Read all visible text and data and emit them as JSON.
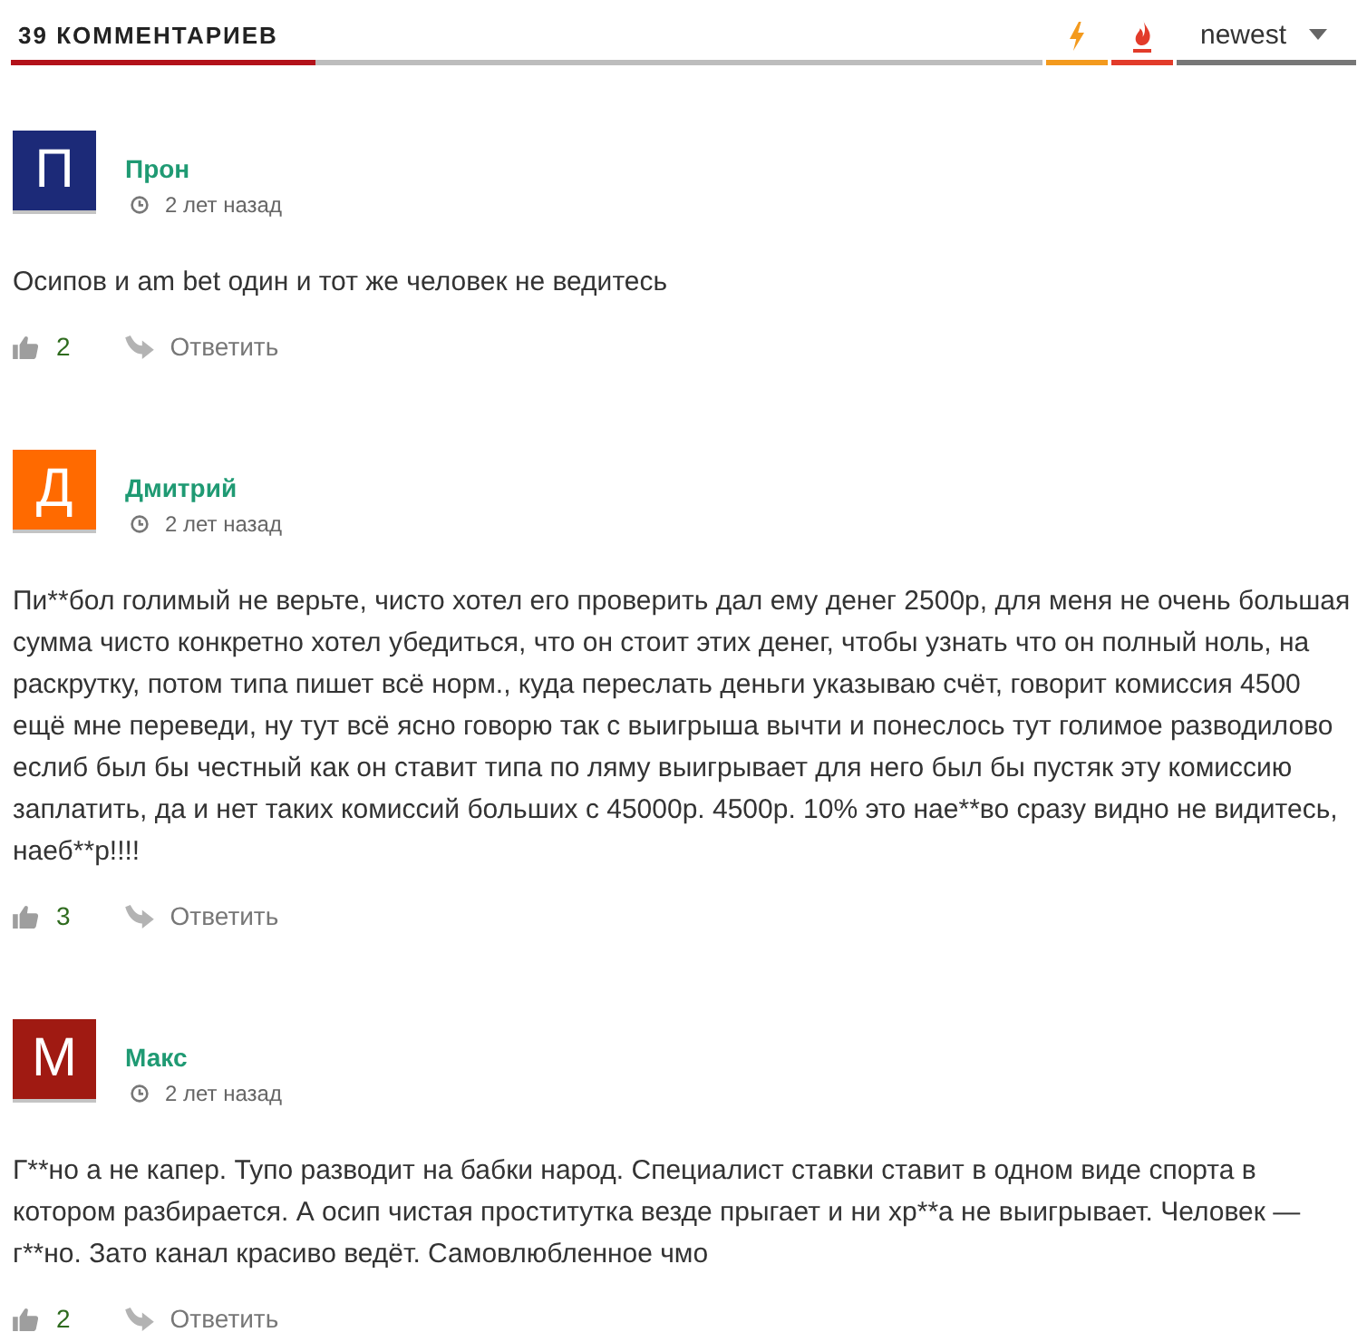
{
  "header": {
    "title": "39 КОММЕНТАРИЕВ"
  },
  "sort": {
    "tabs": [
      {
        "kind": "trending",
        "color": "#f39a1e"
      },
      {
        "kind": "hottest",
        "color": "#e23b2a"
      }
    ],
    "dropdown": {
      "value": "newest"
    }
  },
  "comments": [
    {
      "avatar_letter": "П",
      "color": "#1c2a78",
      "author": "Прон",
      "time": "2 лет назад",
      "text": "Осипов и am bet один и тот же человек не ведитесь",
      "likes": "2",
      "reply": "Ответить"
    },
    {
      "avatar_letter": "Д",
      "color": "#ff6a00",
      "author": "Дмитрий",
      "time": "2 лет назад",
      "text": "Пи**бол голимый не верьте, чисто хотел его проверить дал ему денег 2500р, для меня не очень большая сумма чисто конкретно хотел убедиться, что он стоит этих денег, чтобы узнать что он полный ноль, на раскрутку, потом типа пишет всё норм., куда переслать деньги указываю счёт, говорит комиссия 4500 ещё мне переведи, ну тут всё ясно говорю так с выигрыша вычти и понеслось тут голимое разводилово еслиб был бы честный как он ставит типа по ляму выигрывает для него был бы пустяк эту комиссию заплатить, да и нет таких комиссий больших с 45000р. 4500р. 10% это нае**во сразу видно не видитесь, наеб**р!!!!",
      "likes": "3",
      "reply": "Ответить"
    },
    {
      "avatar_letter": "М",
      "color": "#a01a12",
      "author": "Макс",
      "time": "2 лет назад",
      "text": "Г**но а не капер. Тупо разводит на бабки народ. Специалист ставки ставит в одном виде спорта в котором разбирается. А осип чистая проститутка везде прыгает и ни хр**а не выигрывает. Человек — г**но. Зато канал красиво ведёт. Самовлюбленное чмо",
      "likes": "2",
      "reply": "Ответить"
    }
  ]
}
